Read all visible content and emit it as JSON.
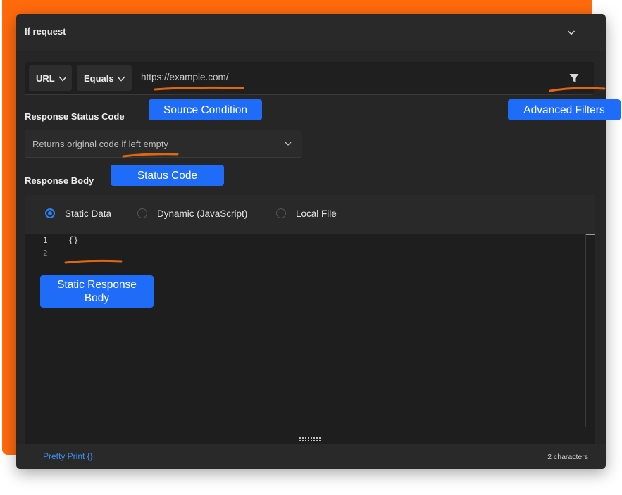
{
  "panel": {
    "title": "If request"
  },
  "condition": {
    "source_type": "URL",
    "operator": "Equals",
    "url_value": "https://example.com/"
  },
  "status_code": {
    "label": "Response Status Code",
    "placeholder": "Returns original code if left empty"
  },
  "response_body": {
    "label": "Response Body",
    "options": [
      {
        "label": "Static Data",
        "selected": true
      },
      {
        "label": "Dynamic (JavaScript)",
        "selected": false
      },
      {
        "label": "Local File",
        "selected": false
      }
    ],
    "editor": {
      "line_numbers": [
        "1",
        "2"
      ],
      "code": "{}"
    }
  },
  "footer": {
    "pretty_print": "Pretty Print {}",
    "char_count": "2 characters"
  },
  "annotations": {
    "source_condition": "Source Condition",
    "advanced_filters": "Advanced Filters",
    "status_code": "Status Code",
    "static_response_body": "Static Response Body"
  },
  "colors": {
    "accent_orange": "#ff6a0d",
    "annotation_blue": "#1f6cf9",
    "panel_bg": "#262627",
    "link_blue": "#3d8cf0"
  },
  "icons": [
    "chevron-down-icon",
    "filter-icon",
    "resize-grip-icon"
  ]
}
